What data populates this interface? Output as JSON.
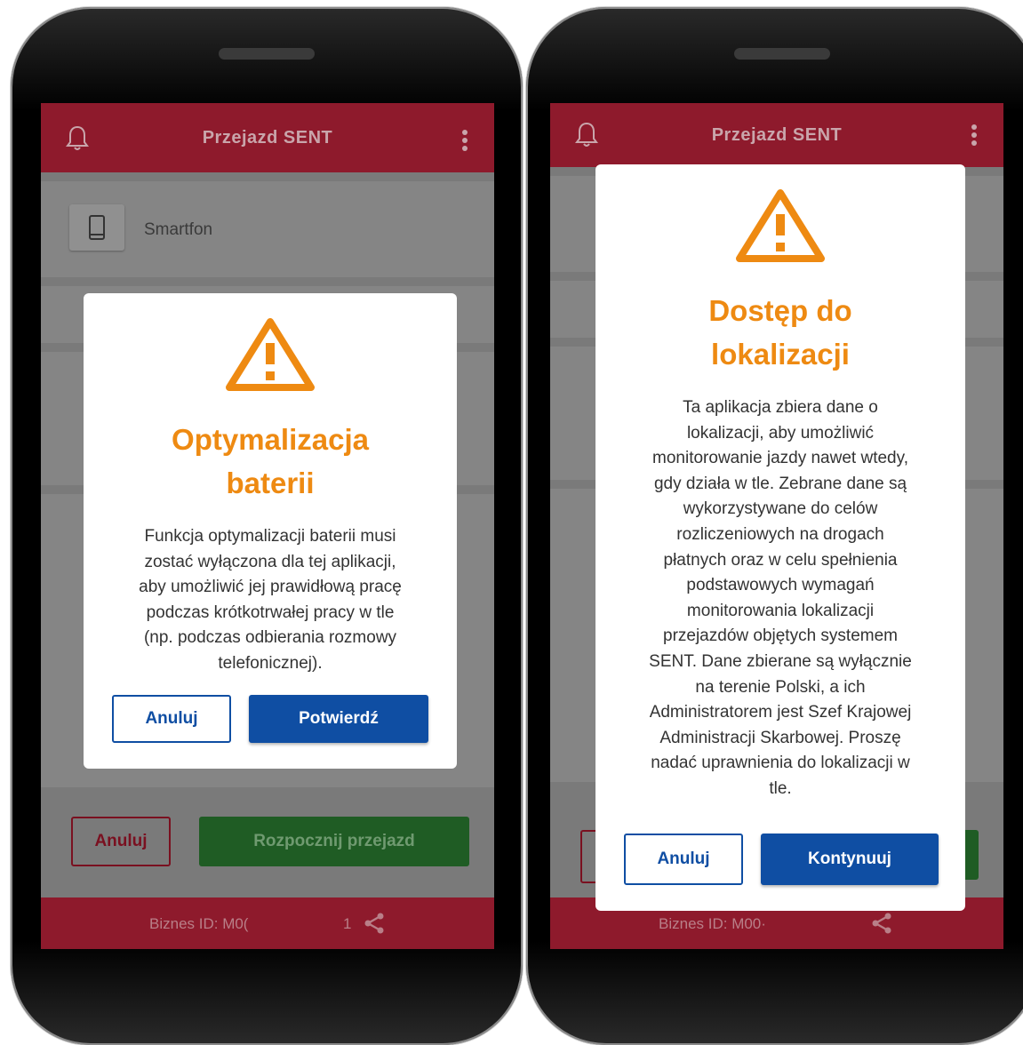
{
  "phone_left": {
    "appbar": {
      "title": "Przejazd SENT"
    },
    "device": {
      "label": "Smartfon"
    },
    "actions": {
      "cancel_label": "Anuluj",
      "start_label": "Rozpocznij przejazd"
    },
    "footer": {
      "business_id": "Biznes ID:  M0(",
      "count": "1"
    },
    "dialog": {
      "title_line1": "Optymalizacja",
      "title_line2": "baterii",
      "body": [
        "Funkcja optymalizacji baterii musi",
        "zostać wyłączona dla tej aplikacji,",
        "aby umożliwić jej prawidłową pracę",
        "podczas krótkotrwałej pracy w tle",
        "(np. podczas odbierania rozmowy",
        "telefonicznej)."
      ],
      "cancel_label": "Anuluj",
      "confirm_label": "Potwierdź"
    }
  },
  "phone_right": {
    "appbar": {
      "title": "Przejazd SENT"
    },
    "footer": {
      "business_id": "Biznes ID:  M00·"
    },
    "dialog": {
      "title_line1": "Dostęp do",
      "title_line2": "lokalizacji",
      "body": [
        "Ta aplikacja zbiera dane o",
        "lokalizacji, aby umożliwić",
        "monitorowanie jazdy nawet wtedy,",
        "gdy działa w tle. Zebrane dane są",
        "wykorzystywane do celów",
        "rozliczeniowych na drogach",
        "płatnych oraz w celu spełnienia",
        "podstawowych wymagań",
        "monitorowania lokalizacji",
        "przejazdów objętych systemem",
        "SENT. Dane zbierane są wyłącznie",
        "na terenie Polski, a ich",
        "Administratorem jest Szef Krajowej",
        "Administracji Skarbowej. Proszę",
        "nadać uprawnienia do lokalizacji w",
        "tle."
      ],
      "cancel_label": "Anuluj",
      "continue_label": "Kontynuuj"
    }
  },
  "colors": {
    "appbar": "#8e1a2c",
    "warning": "#ee8a12",
    "primary_button": "#0f4ea3",
    "start_button": "#1f5c24"
  },
  "icons": [
    "bell-icon",
    "kebab-menu-icon",
    "smartphone-icon",
    "warning-icon",
    "share-icon"
  ]
}
